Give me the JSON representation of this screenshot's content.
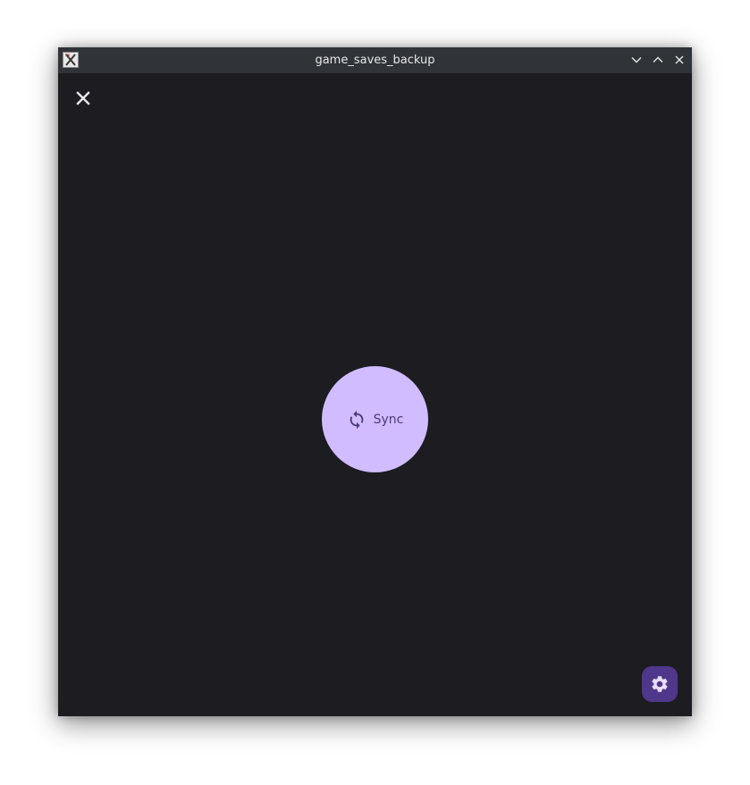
{
  "window": {
    "title": "game_saves_backup",
    "controls": [
      "minimize-icon",
      "maximize-icon",
      "close-icon"
    ]
  },
  "toolbar": {
    "close_icon": "close-icon"
  },
  "main": {
    "sync_label": "Sync",
    "sync_icon": "sync-icon"
  },
  "fab": {
    "icon": "gear-icon"
  },
  "colors": {
    "background": "#1d1c21",
    "titlebar": "#303438",
    "sync_button": "#d0bcff",
    "sync_text": "#4a3a78",
    "fab": "#4f378b",
    "fab_icon": "#e8def8"
  }
}
